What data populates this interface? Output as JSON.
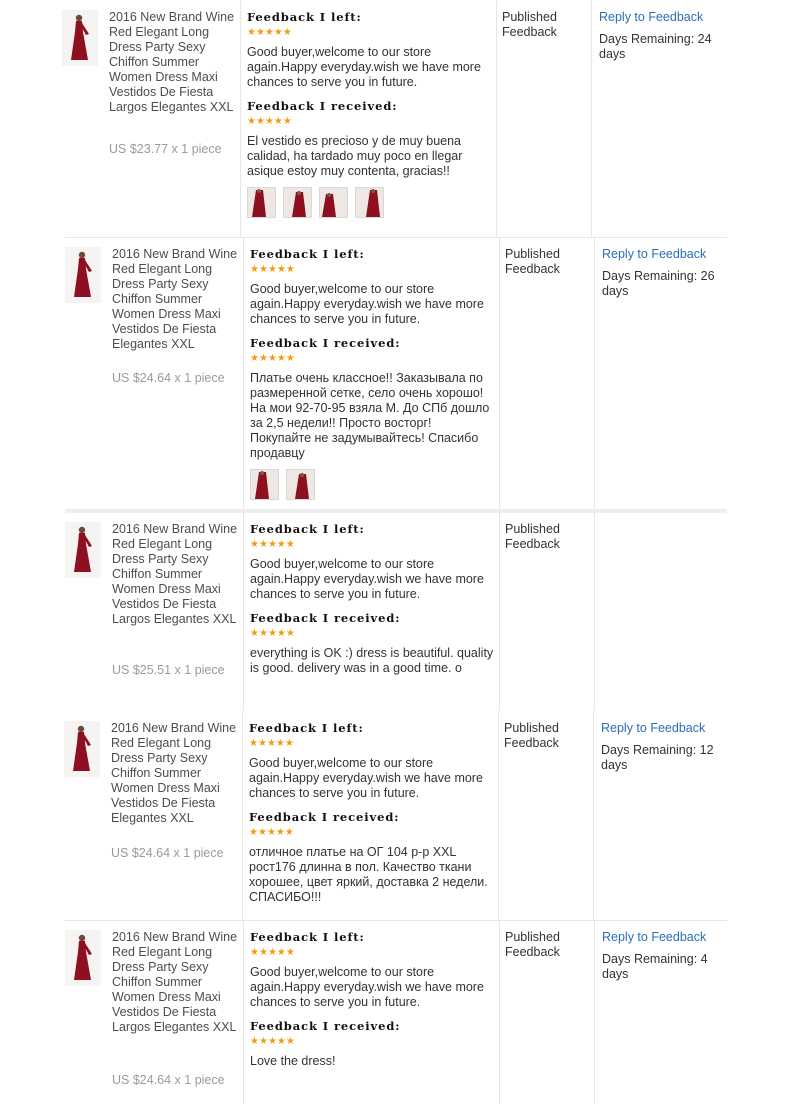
{
  "labels": {
    "feedback_left": "Feedback I left:",
    "feedback_received": "Feedback I received:",
    "status": "Published Feedback",
    "reply": "Reply to Feedback"
  },
  "colors": {
    "star": "#f39c12",
    "link": "#2a6ebb",
    "dress": "#8e0f1f"
  },
  "icons": {
    "star": "star-icon",
    "thumb": "product-thumbnail-icon"
  },
  "rows": [
    {
      "title": "2016 New Brand Wine Red Elegant Long Dress Party Sexy Chiffon Summer Women Dress Maxi Vestidos De Fiesta Largos Elegantes XXL",
      "price": "US $23.77 x 1 piece",
      "left_rating": 5,
      "left_text": "Good buyer,welcome to our store again.Happy everyday.wish we have more chances to serve you in future.",
      "received_rating": 5,
      "received_text": "El vestido es precioso y de muy buena calidad, ha tardado muy poco en llegar asique estoy muy contenta, gracias!!",
      "photo_count": 4,
      "days": "Days Remaining: 24 days"
    },
    {
      "title": "2016 New Brand Wine Red Elegant Long Dress Party Sexy Chiffon Summer Women Dress Maxi Vestidos De Fiesta Elegantes XXL",
      "price": "US $24.64 x 1 piece",
      "left_rating": 5,
      "left_text": "Good buyer,welcome to our store again.Happy everyday.wish we have more chances to serve you in future.",
      "received_rating": 5,
      "received_text": "Платье очень классное!! Заказывала по размеренной сетке, село очень хорошо! На мои 92-70-95 взяла М. До СПб дошло за 2,5 недели!! Просто восторг! Покупайте не задумывайтесь! Спасибо продавцу",
      "photo_count": 2,
      "days": "Days Remaining: 26 days"
    },
    {
      "title": "2016 New Brand Wine Red Elegant Long Dress Party Sexy Chiffon Summer Women Dress Maxi Vestidos De Fiesta Largos Elegantes XXL",
      "price": "US $25.51 x 1 piece",
      "left_rating": 5,
      "left_text": "Good buyer,welcome to our store again.Happy everyday.wish we have more chances to serve you in future.",
      "received_rating": 5,
      "received_text": "everything is OK :) dress is beautiful. quality is good. delivery was in a good time. o",
      "photo_count": 0,
      "days": ""
    },
    {
      "title": "2016 New Brand Wine Red Elegant Long Dress Party Sexy Chiffon Summer Women Dress Maxi Vestidos De Fiesta Elegantes XXL",
      "price": "US $24.64 x 1 piece",
      "left_rating": 5,
      "left_text": "Good buyer,welcome to our store again.Happy everyday.wish we have more chances to serve you in future.",
      "received_rating": 5,
      "received_text": "отличное платье на ОГ 104 р-р XXL рост176 длинна в пол. Качество ткани хорошее, цвет яркий, доставка 2 недели. СПАСИБО!!!",
      "photo_count": 0,
      "days": "Days Remaining: 12 days"
    },
    {
      "title": "2016 New Brand Wine Red Elegant Long Dress Party Sexy Chiffon Summer Women Dress Maxi Vestidos De Fiesta Largos Elegantes XXL",
      "price": "US $24.64 x 1 piece",
      "left_rating": 5,
      "left_text": "Good buyer,welcome to our store again.Happy everyday.wish we have more chances to serve you in future.",
      "received_rating": 5,
      "received_text": "Love the dress!",
      "photo_count": 0,
      "days": "Days Remaining: 4 days"
    }
  ]
}
